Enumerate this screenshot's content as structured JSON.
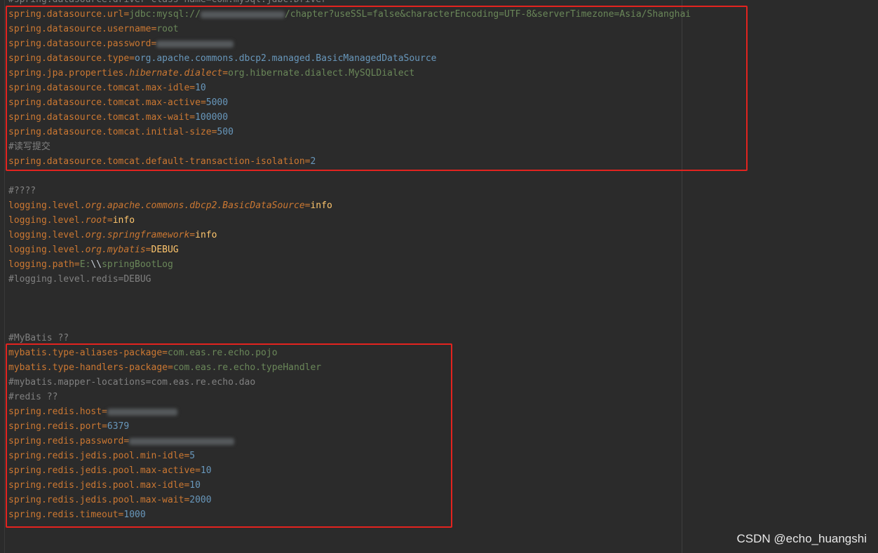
{
  "lines": [
    [
      {
        "t": "#spring.datasource.driver-class-name=com.mysql.jdbc.Driver",
        "c": "c"
      }
    ],
    [
      {
        "t": "spring.datasource.url",
        "c": "k"
      },
      {
        "t": "=",
        "c": "eq"
      },
      {
        "t": "jdbc:mysql://",
        "c": "v"
      },
      {
        "blur": 120
      },
      {
        "t": "/chapter?useSSL=false&characterEncoding=UTF-8&serverTimezone=Asia/Shanghai",
        "c": "v"
      }
    ],
    [
      {
        "t": "spring.datasource.username",
        "c": "k"
      },
      {
        "t": "=",
        "c": "eq"
      },
      {
        "t": "root",
        "c": "v"
      }
    ],
    [
      {
        "t": "spring.datasource.password",
        "c": "k"
      },
      {
        "t": "=",
        "c": "eq"
      },
      {
        "blur": 110
      }
    ],
    [
      {
        "t": "spring.datasource.type",
        "c": "k"
      },
      {
        "t": "=",
        "c": "eq"
      },
      {
        "t": "org.apache.commons.dbcp2.managed.BasicManagedDataSource",
        "c": "n"
      }
    ],
    [
      {
        "t": "spring.jpa.properties.",
        "c": "k"
      },
      {
        "t": "hibernate.dialect",
        "c": "ki"
      },
      {
        "t": "=",
        "c": "eq"
      },
      {
        "t": "org.hibernate.dialect.MySQLDialect",
        "c": "v"
      }
    ],
    [
      {
        "t": "spring.datasource.tomcat.max-idle",
        "c": "k"
      },
      {
        "t": "=",
        "c": "eq"
      },
      {
        "t": "10",
        "c": "n"
      }
    ],
    [
      {
        "t": "spring.datasource.tomcat.max-active",
        "c": "k"
      },
      {
        "t": "=",
        "c": "eq"
      },
      {
        "t": "5000",
        "c": "n"
      }
    ],
    [
      {
        "t": "spring.datasource.tomcat.max-wait",
        "c": "k"
      },
      {
        "t": "=",
        "c": "eq"
      },
      {
        "t": "100000",
        "c": "n"
      }
    ],
    [
      {
        "t": "spring.datasource.tomcat.initial-size",
        "c": "k"
      },
      {
        "t": "=",
        "c": "eq"
      },
      {
        "t": "500",
        "c": "n"
      }
    ],
    [
      {
        "t": "#读写提交",
        "c": "c"
      }
    ],
    [
      {
        "t": "spring.datasource.tomcat.default-transaction-isolation",
        "c": "k"
      },
      {
        "t": "=",
        "c": "eq"
      },
      {
        "t": "2",
        "c": "n"
      }
    ],
    [],
    [
      {
        "t": "#????",
        "c": "c"
      }
    ],
    [
      {
        "t": "logging.level.",
        "c": "k"
      },
      {
        "t": "org.apache.commons.dbcp2.BasicDataSource",
        "c": "ki"
      },
      {
        "t": "=",
        "c": "eq"
      },
      {
        "t": "info",
        "c": "y"
      }
    ],
    [
      {
        "t": "logging.level.",
        "c": "k"
      },
      {
        "t": "root",
        "c": "ki"
      },
      {
        "t": "=",
        "c": "eq"
      },
      {
        "t": "info",
        "c": "y"
      }
    ],
    [
      {
        "t": "logging.level.",
        "c": "k"
      },
      {
        "t": "org.springframework",
        "c": "ki"
      },
      {
        "t": "=",
        "c": "eq"
      },
      {
        "t": "info",
        "c": "y"
      }
    ],
    [
      {
        "t": "logging.level.",
        "c": "k"
      },
      {
        "t": "org.mybatis",
        "c": "ki"
      },
      {
        "t": "=",
        "c": "eq"
      },
      {
        "t": "DEBUG",
        "c": "y"
      }
    ],
    [
      {
        "t": "logging.path",
        "c": "k"
      },
      {
        "t": "=",
        "c": "eq"
      },
      {
        "t": "E:",
        "c": "v"
      },
      {
        "t": "\\\\",
        "c": "w"
      },
      {
        "t": "springBootLog",
        "c": "v"
      }
    ],
    [
      {
        "t": "#logging.level.redis=DEBUG",
        "c": "c"
      }
    ],
    [],
    [],
    [],
    [
      {
        "t": "#MyBatis ??",
        "c": "c"
      }
    ],
    [
      {
        "t": "mybatis.type-aliases-package",
        "c": "k"
      },
      {
        "t": "=",
        "c": "eq"
      },
      {
        "t": "com.eas.re.echo.pojo",
        "c": "v"
      }
    ],
    [
      {
        "t": "mybatis.type-handlers-package",
        "c": "k"
      },
      {
        "t": "=",
        "c": "eq"
      },
      {
        "t": "com.eas.re.echo.typeHandler",
        "c": "v"
      }
    ],
    [
      {
        "t": "#mybatis.mapper-locations=com.eas.re.echo.dao",
        "c": "c"
      }
    ],
    [
      {
        "t": "#redis ??",
        "c": "c"
      }
    ],
    [
      {
        "t": "spring.redis.host",
        "c": "k"
      },
      {
        "t": "=",
        "c": "eq"
      },
      {
        "blur": 100
      }
    ],
    [
      {
        "t": "spring.redis.port",
        "c": "k"
      },
      {
        "t": "=",
        "c": "eq"
      },
      {
        "t": "6379",
        "c": "n"
      }
    ],
    [
      {
        "t": "spring.redis.password",
        "c": "k"
      },
      {
        "t": "=",
        "c": "eq"
      },
      {
        "blur": 150
      }
    ],
    [
      {
        "t": "spring.redis.jedis.pool.min-idle",
        "c": "k"
      },
      {
        "t": "=",
        "c": "eq"
      },
      {
        "t": "5",
        "c": "n"
      }
    ],
    [
      {
        "t": "spring.redis.jedis.pool.max-active",
        "c": "k"
      },
      {
        "t": "=",
        "c": "eq"
      },
      {
        "t": "10",
        "c": "n"
      }
    ],
    [
      {
        "t": "spring.redis.jedis.pool.max-idle",
        "c": "k"
      },
      {
        "t": "=",
        "c": "eq"
      },
      {
        "t": "10",
        "c": "n"
      }
    ],
    [
      {
        "t": "spring.redis.jedis.pool.max-wait",
        "c": "k"
      },
      {
        "t": "=",
        "c": "eq"
      },
      {
        "t": "2000",
        "c": "n"
      }
    ],
    [
      {
        "t": "spring.redis.timeout",
        "c": "k"
      },
      {
        "t": "=",
        "c": "eq"
      },
      {
        "t": "1000",
        "c": "n"
      }
    ]
  ],
  "watermark": "CSDN @echo_huangshi"
}
